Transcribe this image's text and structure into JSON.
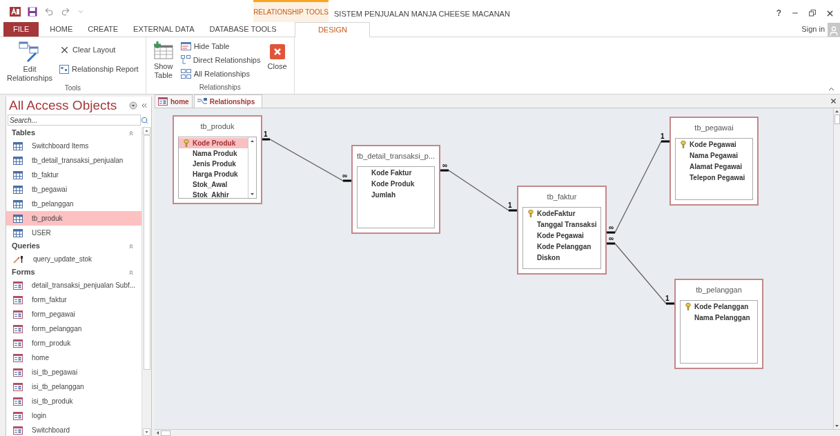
{
  "window": {
    "title": "SISTEM PENJUALAN MANJA CHEESE MACANAN",
    "contextual_group": "RELATIONSHIP TOOLS",
    "help": "?",
    "sign_in": "Sign in"
  },
  "ribbon_tabs": [
    {
      "label": "FILE",
      "kind": "file",
      "selected": false
    },
    {
      "label": "HOME",
      "kind": "tab",
      "selected": false
    },
    {
      "label": "CREATE",
      "kind": "tab",
      "selected": false
    },
    {
      "label": "EXTERNAL DATA",
      "kind": "tab",
      "selected": false
    },
    {
      "label": "DATABASE TOOLS",
      "kind": "tab",
      "selected": false
    },
    {
      "label": "DESIGN",
      "kind": "contextual",
      "selected": true
    }
  ],
  "ribbon_groups": [
    {
      "label": "Tools",
      "commands": [
        {
          "label": "Edit Relationships",
          "kind": "edit-relationships"
        },
        {
          "label": "Clear Layout",
          "kind": "clear-layout"
        },
        {
          "label": "Relationship Report",
          "kind": "report"
        }
      ]
    },
    {
      "label": "Relationships",
      "commands": [
        {
          "label": "Show Table",
          "kind": "show-table"
        },
        {
          "label": "Hide Table",
          "kind": "hide-table"
        },
        {
          "label": "Direct Relationships",
          "kind": "direct"
        },
        {
          "label": "All Relationships",
          "kind": "all"
        },
        {
          "label": "Close",
          "kind": "close"
        }
      ]
    }
  ],
  "nav": {
    "title": "All Access Objects",
    "search": {
      "placeholder": "Search..."
    },
    "groups": [
      {
        "title": "Tables",
        "kind": "table",
        "items": [
          {
            "label": "Switchboard Items",
            "selected": false
          },
          {
            "label": "tb_detail_transaksi_penjualan",
            "selected": false
          },
          {
            "label": "tb_faktur",
            "selected": false
          },
          {
            "label": "tb_pegawai",
            "selected": false
          },
          {
            "label": "tb_pelanggan",
            "selected": false
          },
          {
            "label": "tb_produk",
            "selected": true
          },
          {
            "label": "USER",
            "selected": false
          }
        ]
      },
      {
        "title": "Queries",
        "kind": "query",
        "items": [
          {
            "label": "query_update_stok",
            "selected": false
          }
        ]
      },
      {
        "title": "Forms",
        "kind": "form",
        "items": [
          {
            "label": "detail_transaksi_penjualan Subf...",
            "selected": false
          },
          {
            "label": "form_faktur",
            "selected": false
          },
          {
            "label": "form_pegawai",
            "selected": false
          },
          {
            "label": "form_pelanggan",
            "selected": false
          },
          {
            "label": "form_produk",
            "selected": false
          },
          {
            "label": "home",
            "selected": false
          },
          {
            "label": "isi_tb_pegawai",
            "selected": false
          },
          {
            "label": "isi_tb_pelanggan",
            "selected": false
          },
          {
            "label": "isi_tb_produk",
            "selected": false
          },
          {
            "label": "login",
            "selected": false
          },
          {
            "label": "Switchboard",
            "selected": false
          }
        ]
      }
    ]
  },
  "doc_tabs": [
    {
      "label": "home",
      "kind": "form",
      "selected": false
    },
    {
      "label": "Relationships",
      "kind": "relationships",
      "selected": true
    }
  ],
  "tables": [
    {
      "name": "tb_produk",
      "scrollable": true,
      "fields": [
        {
          "name": "Kode Produk",
          "key": true,
          "selected": true
        },
        {
          "name": "Nama Produk",
          "key": false,
          "selected": false
        },
        {
          "name": "Jenis Produk",
          "key": false,
          "selected": false
        },
        {
          "name": "Harga Produk",
          "key": false,
          "selected": false
        },
        {
          "name": "Stok_Awal",
          "key": false,
          "selected": false
        },
        {
          "name": "Stok_Akhir",
          "key": false,
          "selected": false
        }
      ]
    },
    {
      "name": "tb_detail_transaksi_p...",
      "scrollable": false,
      "fields": [
        {
          "name": "Kode Faktur",
          "key": false,
          "selected": false
        },
        {
          "name": "Kode Produk",
          "key": false,
          "selected": false
        },
        {
          "name": "Jumlah",
          "key": false,
          "selected": false
        }
      ]
    },
    {
      "name": "tb_faktur",
      "scrollable": false,
      "fields": [
        {
          "name": "KodeFaktur",
          "key": true,
          "selected": false
        },
        {
          "name": "Tanggal  Transaksi",
          "key": false,
          "selected": false
        },
        {
          "name": "Kode Pegawai",
          "key": false,
          "selected": false
        },
        {
          "name": "Kode Pelanggan",
          "key": false,
          "selected": false
        },
        {
          "name": "Diskon",
          "key": false,
          "selected": false
        }
      ]
    },
    {
      "name": "tb_pegawai",
      "scrollable": false,
      "fields": [
        {
          "name": "Kode Pegawai",
          "key": true,
          "selected": false
        },
        {
          "name": "Nama Pegawai",
          "key": false,
          "selected": false
        },
        {
          "name": "Alamat Pegawai",
          "key": false,
          "selected": false
        },
        {
          "name": "Telepon Pegawai",
          "key": false,
          "selected": false
        }
      ]
    },
    {
      "name": "tb_pelanggan",
      "scrollable": false,
      "fields": [
        {
          "name": "Kode Pelanggan",
          "key": true,
          "selected": false
        },
        {
          "name": "Nama Pelanggan",
          "key": false,
          "selected": false
        }
      ]
    }
  ],
  "relationships": [
    {
      "start_label": "1",
      "end_label": "∞"
    },
    {
      "start_label": "∞",
      "end_label": "1"
    },
    {
      "start_label": "∞",
      "end_label": "1"
    },
    {
      "start_label": "∞",
      "end_label": "1"
    }
  ]
}
